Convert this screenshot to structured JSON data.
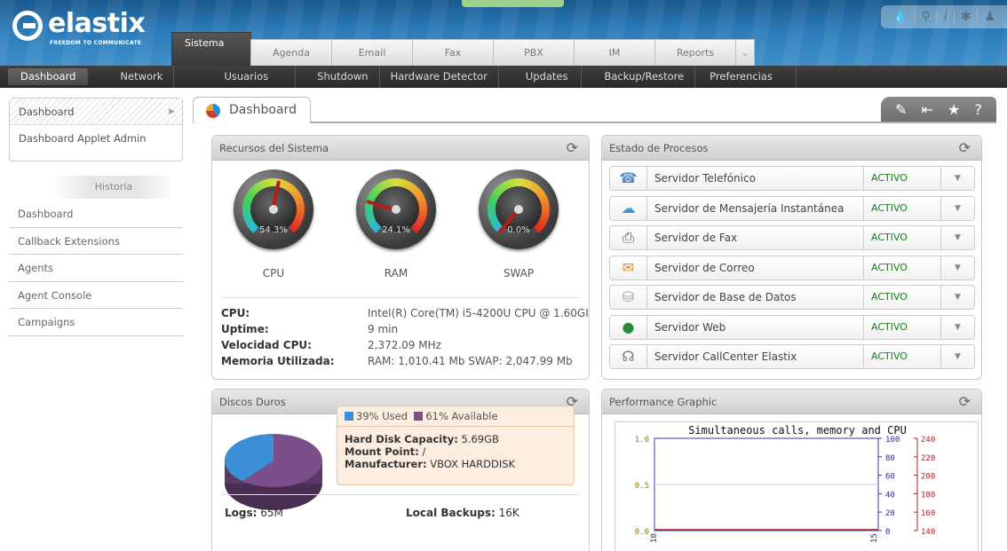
{
  "brand": {
    "name": "elastix",
    "tagline": "FREEDOM TO COMMUNICATE"
  },
  "top_tools": [
    "drop-icon",
    "search-icon",
    "info-icon",
    "tools-icon",
    "user-icon"
  ],
  "tabs": [
    "Sistema",
    "Agenda",
    "Email",
    "Fax",
    "PBX",
    "IM",
    "Reports"
  ],
  "subnav": [
    "Dashboard",
    "Network",
    "Usuarios",
    "Shutdown",
    "Hardware Detector",
    "Updates",
    "Backup/Restore",
    "Preferencias"
  ],
  "sidebar": {
    "menu": [
      "Dashboard",
      "Dashboard Applet Admin"
    ],
    "history_label": "Historia",
    "history": [
      "Dashboard",
      "Callback Extensions",
      "Agents",
      "Agent Console",
      "Campaigns"
    ]
  },
  "main": {
    "title": "Dashboard"
  },
  "resources": {
    "title": "Recursos del Sistema",
    "gauges": [
      {
        "label": "CPU",
        "value": "54.3%",
        "percent": 54.3
      },
      {
        "label": "RAM",
        "value": "24.1%",
        "percent": 24.1
      },
      {
        "label": "SWAP",
        "value": "0.0%",
        "percent": 0
      }
    ],
    "info": [
      {
        "k": "CPU:",
        "v": "Intel(R) Core(TM) i5-4200U CPU @ 1.60GI"
      },
      {
        "k": "Uptime:",
        "v": "9 min"
      },
      {
        "k": "Velocidad CPU:",
        "v": "2,372.09 MHz"
      },
      {
        "k": "Memoria Utilizada:",
        "v": "RAM: 1,010.41 Mb SWAP: 2,047.99 Mb"
      }
    ]
  },
  "processes": {
    "title": "Estado de Procesos",
    "items": [
      {
        "name": "Servidor Telefónico",
        "status": "ACTIVO",
        "icon": "phone-icon"
      },
      {
        "name": "Servidor de Mensajería Instantánea",
        "status": "ACTIVO",
        "icon": "chat-icon"
      },
      {
        "name": "Servidor de Fax",
        "status": "ACTIVO",
        "icon": "fax-icon"
      },
      {
        "name": "Servidor de Correo",
        "status": "ACTIVO",
        "icon": "mail-icon"
      },
      {
        "name": "Servidor de Base de Datos",
        "status": "ACTIVO",
        "icon": "database-icon"
      },
      {
        "name": "Servidor Web",
        "status": "ACTIVO",
        "icon": "globe-icon"
      },
      {
        "name": "Servidor CallCenter Elastix",
        "status": "ACTIVO",
        "icon": "headset-icon"
      }
    ]
  },
  "disks": {
    "title": "Discos Duros",
    "used_label": "39% Used",
    "available_label": "61% Available",
    "used_color": "#3b8fd6",
    "available_color": "#7a4f8a",
    "capacity_key": "Hard Disk Capacity:",
    "capacity_val": "5.69GB",
    "mount_key": "Mount Point:",
    "mount_val": "/",
    "manufacturer_key": "Manufacturer:",
    "manufacturer_val": "VBOX HARDDISK",
    "logs_key": "Logs:",
    "logs_val": "65M",
    "backups_key": "Local Backups:",
    "backups_val": "16K"
  },
  "performance": {
    "title": "Performance Graphic",
    "chart_title": "Simultaneous calls, memory and CPU"
  },
  "chart_data": {
    "type": "line",
    "title": "Simultaneous calls, memory and CPU",
    "y_left_ticks": [
      "1.0",
      "0.5",
      "0.0"
    ],
    "y_mid_ticks": [
      "100",
      "80",
      "60",
      "40",
      "20",
      "0"
    ],
    "y_right_ticks": [
      "240",
      "220",
      "200",
      "180",
      "160",
      "140"
    ],
    "x_ticks": [
      "10",
      "15"
    ],
    "series": [],
    "grid": true
  }
}
